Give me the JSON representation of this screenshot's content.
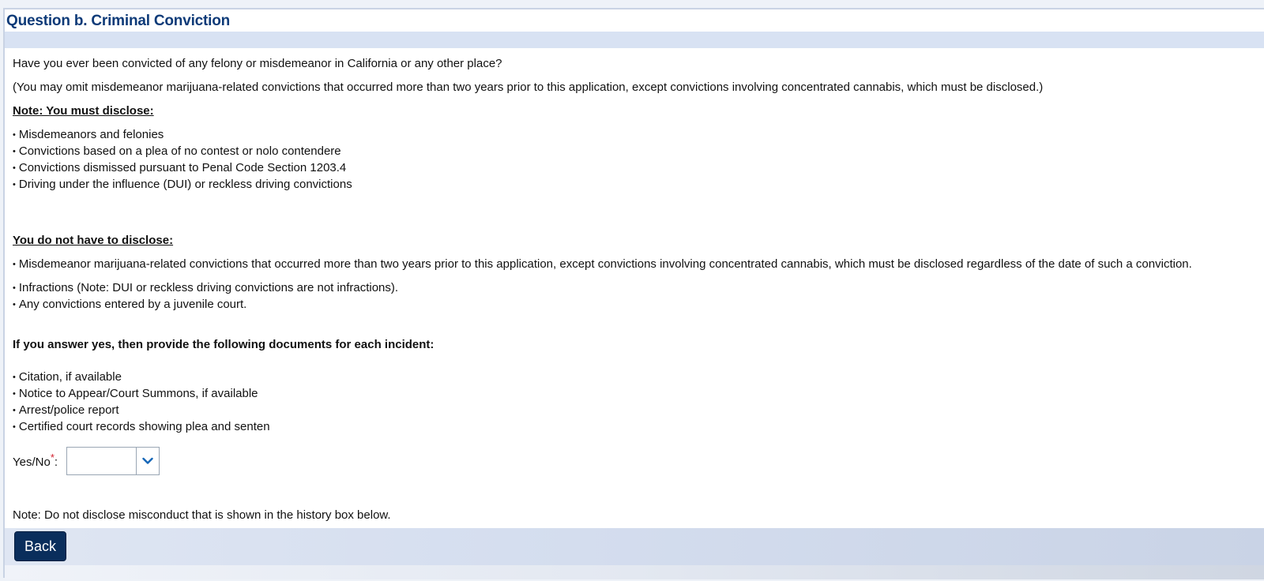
{
  "header": {
    "title": "Question b. Criminal Conviction"
  },
  "question": {
    "main": "Have you ever been convicted of any felony or misdemeanor in California or any other place?",
    "omit_note": "(You may omit misdemeanor marijuana-related convictions that occurred more than two years prior to this application, except convictions involving concentrated cannabis, which must be disclosed.)"
  },
  "must_disclose": {
    "heading": "Note: You must disclose:",
    "items": [
      "Misdemeanors and felonies",
      "Convictions based on a plea of no contest or nolo contendere",
      "Convictions dismissed pursuant to Penal Code Section 1203.4",
      "Driving under the influence (DUI) or reckless driving convictions"
    ]
  },
  "not_disclose": {
    "heading": "You do not have to disclose:",
    "items": [
      "Misdemeanor marijuana-related convictions that occurred more than two years prior to this application, except convictions involving concentrated cannabis, which must be disclosed regardless of the date of such a conviction.",
      "Infractions (Note: DUI or reckless driving convictions are not infractions).",
      "Any convictions entered by a juvenile court."
    ]
  },
  "documents": {
    "heading": "If you answer yes, then provide the following documents for each incident:",
    "items": [
      "Citation, if available",
      "Notice to Appear/Court Summons, if available",
      "Arrest/police report",
      "Certified court records showing plea and senten"
    ]
  },
  "yes_no": {
    "label": "Yes/No",
    "required_mark": "*",
    "colon": ":",
    "value": ""
  },
  "history_note": "Note: Do not disclose misconduct that is shown in the history box below.",
  "footer": {
    "back_label": "Back"
  },
  "colors": {
    "title": "#0d3a78",
    "band": "#d8e2f3",
    "button": "#0a2e5c",
    "required": "#d21f2c"
  },
  "icons": {
    "select_arrow": "chevron-down-icon"
  }
}
